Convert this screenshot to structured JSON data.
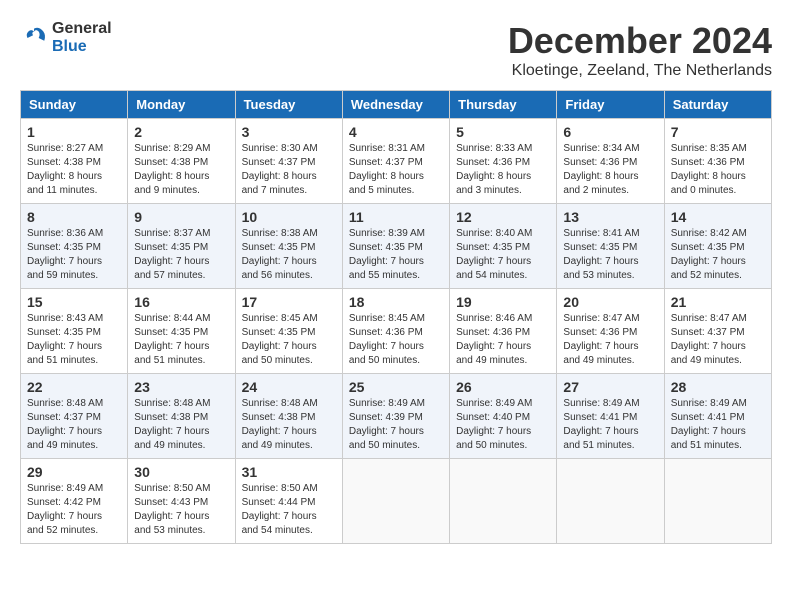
{
  "header": {
    "logo": {
      "general": "General",
      "blue": "Blue"
    },
    "title": "December 2024",
    "subtitle": "Kloetinge, Zeeland, The Netherlands"
  },
  "weekdays": [
    "Sunday",
    "Monday",
    "Tuesday",
    "Wednesday",
    "Thursday",
    "Friday",
    "Saturday"
  ],
  "weeks": [
    [
      {
        "day": "1",
        "sunrise": "8:27 AM",
        "sunset": "4:38 PM",
        "daylight": "8 hours and 11 minutes."
      },
      {
        "day": "2",
        "sunrise": "8:29 AM",
        "sunset": "4:38 PM",
        "daylight": "8 hours and 9 minutes."
      },
      {
        "day": "3",
        "sunrise": "8:30 AM",
        "sunset": "4:37 PM",
        "daylight": "8 hours and 7 minutes."
      },
      {
        "day": "4",
        "sunrise": "8:31 AM",
        "sunset": "4:37 PM",
        "daylight": "8 hours and 5 minutes."
      },
      {
        "day": "5",
        "sunrise": "8:33 AM",
        "sunset": "4:36 PM",
        "daylight": "8 hours and 3 minutes."
      },
      {
        "day": "6",
        "sunrise": "8:34 AM",
        "sunset": "4:36 PM",
        "daylight": "8 hours and 2 minutes."
      },
      {
        "day": "7",
        "sunrise": "8:35 AM",
        "sunset": "4:36 PM",
        "daylight": "8 hours and 0 minutes."
      }
    ],
    [
      {
        "day": "8",
        "sunrise": "8:36 AM",
        "sunset": "4:35 PM",
        "daylight": "7 hours and 59 minutes."
      },
      {
        "day": "9",
        "sunrise": "8:37 AM",
        "sunset": "4:35 PM",
        "daylight": "7 hours and 57 minutes."
      },
      {
        "day": "10",
        "sunrise": "8:38 AM",
        "sunset": "4:35 PM",
        "daylight": "7 hours and 56 minutes."
      },
      {
        "day": "11",
        "sunrise": "8:39 AM",
        "sunset": "4:35 PM",
        "daylight": "7 hours and 55 minutes."
      },
      {
        "day": "12",
        "sunrise": "8:40 AM",
        "sunset": "4:35 PM",
        "daylight": "7 hours and 54 minutes."
      },
      {
        "day": "13",
        "sunrise": "8:41 AM",
        "sunset": "4:35 PM",
        "daylight": "7 hours and 53 minutes."
      },
      {
        "day": "14",
        "sunrise": "8:42 AM",
        "sunset": "4:35 PM",
        "daylight": "7 hours and 52 minutes."
      }
    ],
    [
      {
        "day": "15",
        "sunrise": "8:43 AM",
        "sunset": "4:35 PM",
        "daylight": "7 hours and 51 minutes."
      },
      {
        "day": "16",
        "sunrise": "8:44 AM",
        "sunset": "4:35 PM",
        "daylight": "7 hours and 51 minutes."
      },
      {
        "day": "17",
        "sunrise": "8:45 AM",
        "sunset": "4:35 PM",
        "daylight": "7 hours and 50 minutes."
      },
      {
        "day": "18",
        "sunrise": "8:45 AM",
        "sunset": "4:36 PM",
        "daylight": "7 hours and 50 minutes."
      },
      {
        "day": "19",
        "sunrise": "8:46 AM",
        "sunset": "4:36 PM",
        "daylight": "7 hours and 49 minutes."
      },
      {
        "day": "20",
        "sunrise": "8:47 AM",
        "sunset": "4:36 PM",
        "daylight": "7 hours and 49 minutes."
      },
      {
        "day": "21",
        "sunrise": "8:47 AM",
        "sunset": "4:37 PM",
        "daylight": "7 hours and 49 minutes."
      }
    ],
    [
      {
        "day": "22",
        "sunrise": "8:48 AM",
        "sunset": "4:37 PM",
        "daylight": "7 hours and 49 minutes."
      },
      {
        "day": "23",
        "sunrise": "8:48 AM",
        "sunset": "4:38 PM",
        "daylight": "7 hours and 49 minutes."
      },
      {
        "day": "24",
        "sunrise": "8:48 AM",
        "sunset": "4:38 PM",
        "daylight": "7 hours and 49 minutes."
      },
      {
        "day": "25",
        "sunrise": "8:49 AM",
        "sunset": "4:39 PM",
        "daylight": "7 hours and 50 minutes."
      },
      {
        "day": "26",
        "sunrise": "8:49 AM",
        "sunset": "4:40 PM",
        "daylight": "7 hours and 50 minutes."
      },
      {
        "day": "27",
        "sunrise": "8:49 AM",
        "sunset": "4:41 PM",
        "daylight": "7 hours and 51 minutes."
      },
      {
        "day": "28",
        "sunrise": "8:49 AM",
        "sunset": "4:41 PM",
        "daylight": "7 hours and 51 minutes."
      }
    ],
    [
      {
        "day": "29",
        "sunrise": "8:49 AM",
        "sunset": "4:42 PM",
        "daylight": "7 hours and 52 minutes."
      },
      {
        "day": "30",
        "sunrise": "8:50 AM",
        "sunset": "4:43 PM",
        "daylight": "7 hours and 53 minutes."
      },
      {
        "day": "31",
        "sunrise": "8:50 AM",
        "sunset": "4:44 PM",
        "daylight": "7 hours and 54 minutes."
      },
      null,
      null,
      null,
      null
    ]
  ],
  "labels": {
    "sunrise": "Sunrise:",
    "sunset": "Sunset:",
    "daylight": "Daylight:"
  }
}
